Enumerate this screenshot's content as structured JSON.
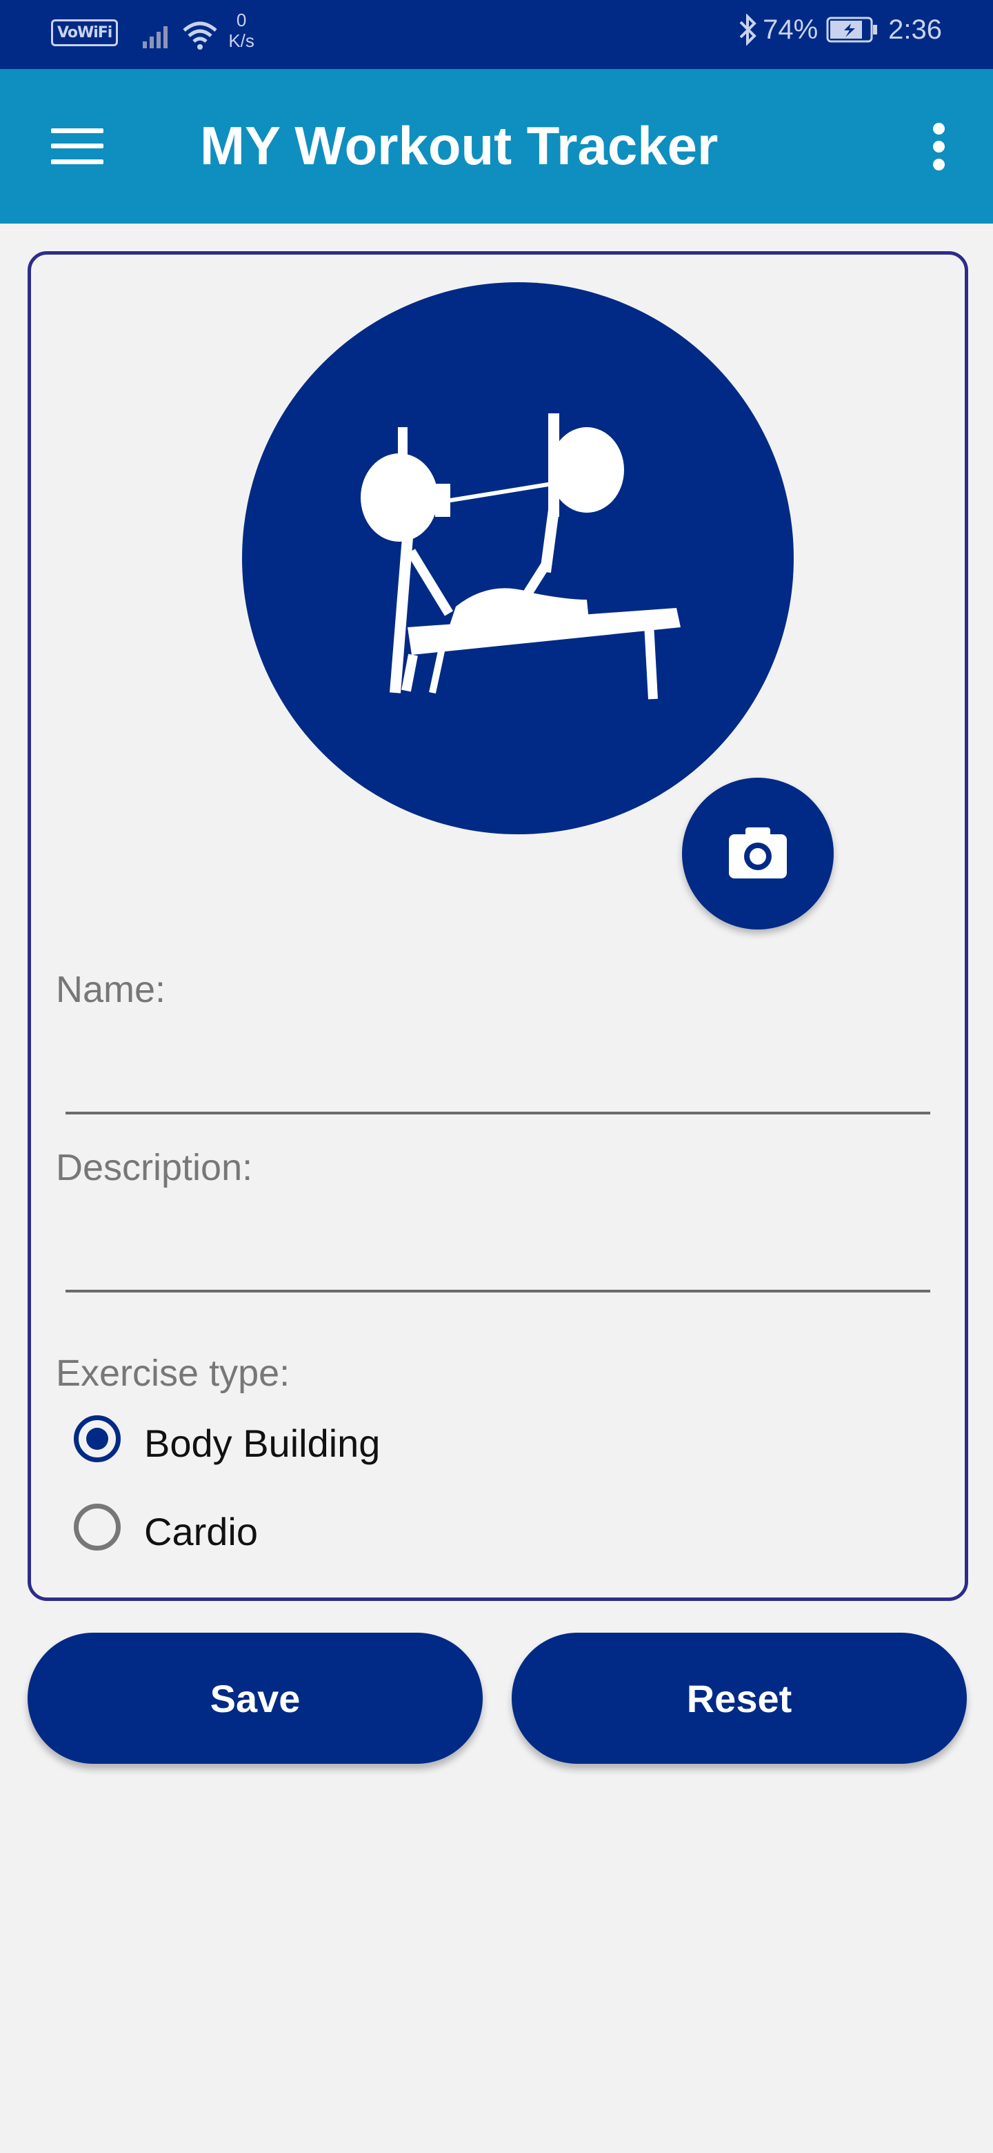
{
  "status_bar": {
    "vowifi": "VoWiFi",
    "speed_value": "0",
    "speed_unit": "K/s",
    "battery": "74%",
    "time": "2:36"
  },
  "app_bar": {
    "title": "MY Workout Tracker",
    "menu_icon": "hamburger-menu-icon",
    "overflow_icon": "more-vert-icon"
  },
  "form": {
    "image_icon": "bench-press-icon",
    "camera_icon": "camera-icon",
    "name_label": "Name:",
    "name_value": "",
    "description_label": "Description:",
    "description_value": "",
    "exercise_type_label": "Exercise type:",
    "options": [
      {
        "label": "Body Building",
        "selected": true
      },
      {
        "label": "Cardio",
        "selected": false
      }
    ]
  },
  "actions": {
    "save_label": "Save",
    "reset_label": "Reset"
  },
  "colors": {
    "primary": "#012a86",
    "app_bar": "#0e8fbf",
    "card_border": "#2c2c8c",
    "background": "#f2f2f2"
  }
}
